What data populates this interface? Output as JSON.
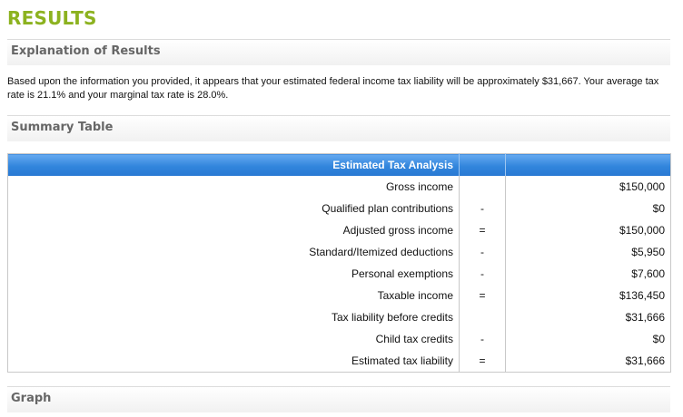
{
  "page": {
    "title": "RESULTS"
  },
  "sections": {
    "explanation": {
      "title": "Explanation of Results",
      "text": "Based upon the information you provided, it appears that your estimated federal income tax liability will be approximately $31,667. Your average tax rate is 21.1% and your marginal tax rate is 28.0%."
    },
    "summary": {
      "title": "Summary Table"
    },
    "graph": {
      "title": "Graph"
    }
  },
  "table": {
    "header": {
      "label": "Estimated Tax Analysis",
      "op": "",
      "value": ""
    },
    "rows": [
      {
        "label": "Gross income",
        "op": "",
        "value": "$150,000"
      },
      {
        "label": "Qualified plan contributions",
        "op": "-",
        "value": "$0"
      },
      {
        "label": "Adjusted gross income",
        "op": "=",
        "value": "$150,000"
      },
      {
        "label": "Standard/Itemized deductions",
        "op": "-",
        "value": "$5,950"
      },
      {
        "label": "Personal exemptions",
        "op": "-",
        "value": "$7,600"
      },
      {
        "label": "Taxable income",
        "op": "=",
        "value": "$136,450"
      },
      {
        "label": "Tax liability before credits",
        "op": "",
        "value": "$31,666"
      },
      {
        "label": "Child tax credits",
        "op": "-",
        "value": "$0"
      },
      {
        "label": "Estimated tax liability",
        "op": "=",
        "value": "$31,666"
      }
    ]
  }
}
